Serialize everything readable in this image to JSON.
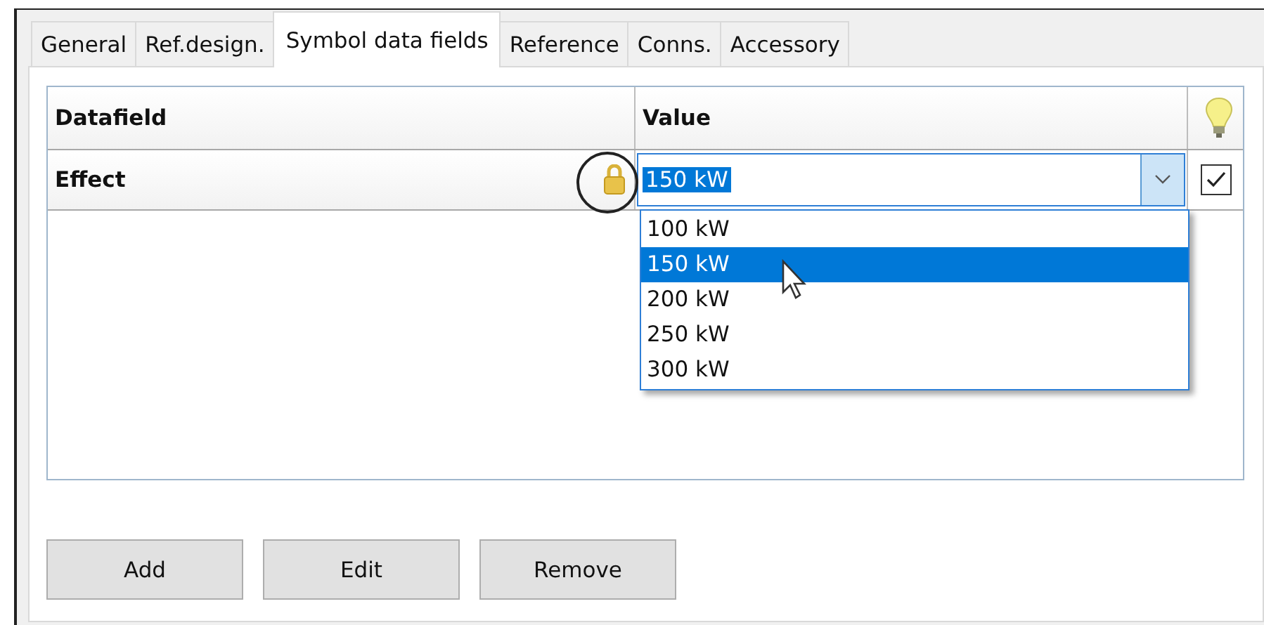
{
  "tabs": [
    {
      "label": "General",
      "selected": false
    },
    {
      "label": "Ref.design.",
      "selected": false
    },
    {
      "label": "Symbol data fields",
      "selected": true
    },
    {
      "label": "Reference",
      "selected": false
    },
    {
      "label": "Conns.",
      "selected": false
    },
    {
      "label": "Accessory",
      "selected": false
    }
  ],
  "table": {
    "columns": [
      "Datafield",
      "Value"
    ],
    "rows": [
      {
        "datafield": "Effect",
        "locked": true,
        "value": "150 kW",
        "checked": true
      }
    ]
  },
  "dropdown": {
    "expanded": true,
    "options": [
      {
        "label": "100 kW",
        "selected": false
      },
      {
        "label": "150 kW",
        "selected": true
      },
      {
        "label": "200 kW",
        "selected": false
      },
      {
        "label": "250 kW",
        "selected": false
      },
      {
        "label": "300 kW",
        "selected": false
      }
    ]
  },
  "buttons": [
    "Add",
    "Edit",
    "Remove"
  ]
}
